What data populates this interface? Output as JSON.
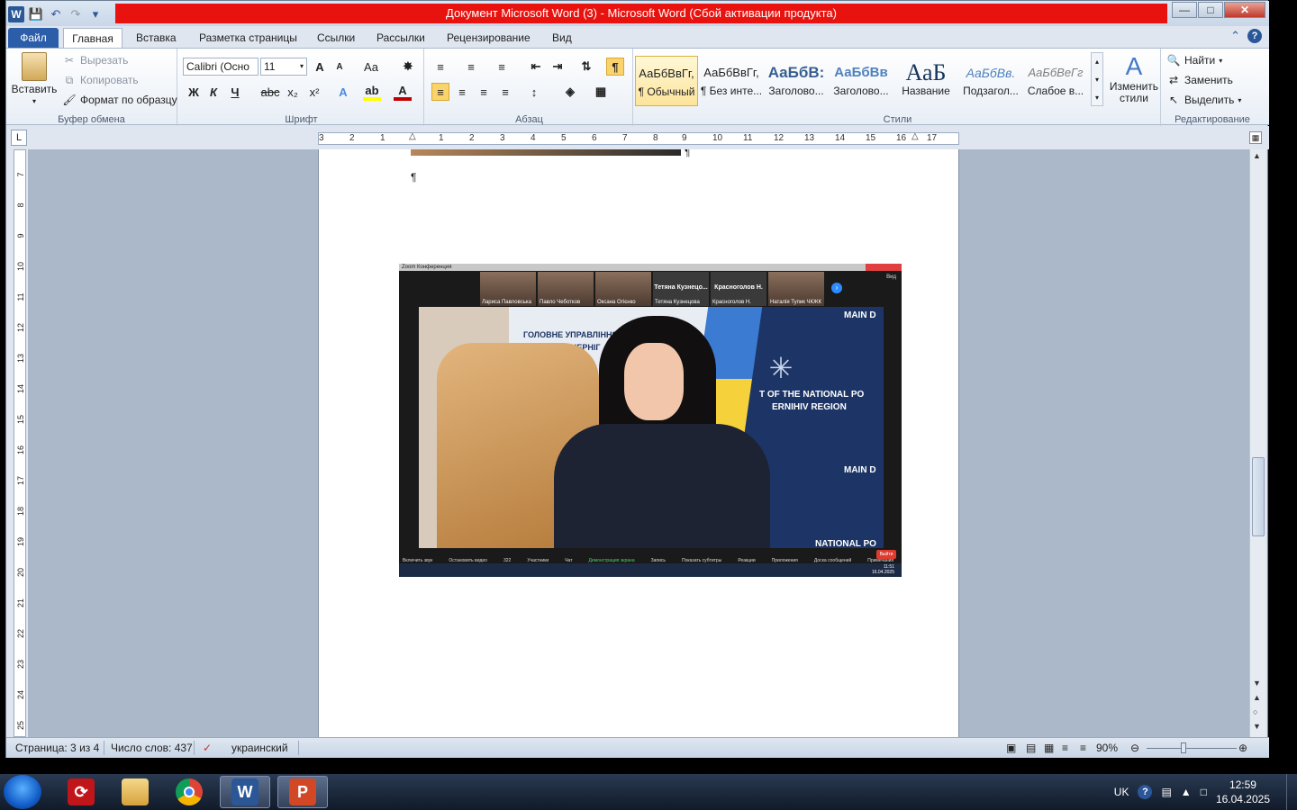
{
  "window": {
    "title": "Документ Microsoft Word (3)  -  Microsoft Word (Сбой активации продукта)"
  },
  "tabs": {
    "file": "Файл",
    "items": [
      "Главная",
      "Вставка",
      "Разметка страницы",
      "Ссылки",
      "Рассылки",
      "Рецензирование",
      "Вид"
    ]
  },
  "clipboard": {
    "paste": "Вставить",
    "cut": "Вырезать",
    "copy": "Копировать",
    "format_painter": "Формат по образцу",
    "label": "Буфер обмена"
  },
  "font": {
    "name": "Calibri (Осно",
    "size": "11",
    "label": "Шрифт",
    "bold": "Ж",
    "italic": "К",
    "underline": "Ч",
    "strike": "abc",
    "sub": "x₂",
    "sup": "x²",
    "grow": "A",
    "shrink": "A",
    "case": "Aa"
  },
  "paragraph": {
    "label": "Абзац",
    "pilcrow": "¶"
  },
  "styles": {
    "label": "Стили",
    "items": [
      {
        "sample": "АаБбВвГг,",
        "name": "¶ Обычный"
      },
      {
        "sample": "АаБбВвГг,",
        "name": "¶ Без инте..."
      },
      {
        "sample": "АаБбВ:",
        "name": "Заголово..."
      },
      {
        "sample": "АаБбВв",
        "name": "Заголово..."
      },
      {
        "sample": "АаБ",
        "name": "Название"
      },
      {
        "sample": "АаБбВв.",
        "name": "Подзагол..."
      },
      {
        "sample": "АаБбВеГг",
        "name": "Слабое в..."
      }
    ],
    "change": "Изменить стили"
  },
  "editing": {
    "label": "Редактирование",
    "find": "Найти",
    "replace": "Заменить",
    "select": "Выделить"
  },
  "ruler": {
    "corner": "L",
    "marks": [
      "3",
      "2",
      "1",
      "1",
      "2",
      "3",
      "4",
      "5",
      "6",
      "7",
      "8",
      "9",
      "10",
      "11",
      "12",
      "13",
      "14",
      "15",
      "16",
      "17"
    ],
    "vmarks": [
      "7",
      "8",
      "9",
      "10",
      "11",
      "12",
      "13",
      "14",
      "15",
      "16",
      "17",
      "18",
      "19",
      "20",
      "21",
      "22",
      "23",
      "24",
      "25"
    ]
  },
  "document": {
    "pilcrow1": "¶",
    "pilcrow2": "¶"
  },
  "embedded": {
    "zoom_title": "Zoom Конференция",
    "participants": [
      {
        "label": "Лариса Павловська"
      },
      {
        "label": "Павло Чеботков"
      },
      {
        "label": "Оксана Огієнко"
      },
      {
        "title": "Тетяна Кузнецо...",
        "label": "Тетяна Кузнецова"
      },
      {
        "title": "Красноголов Н.",
        "label": "Красноголов Н."
      },
      {
        "label": "Наталія Тупик ЧКЖК"
      }
    ],
    "view": "Вид",
    "banner_left_1": "ГОЛОВНЕ УПРАВЛІННЯ",
    "banner_left_2": "В ЧЕРНІГ",
    "banner_right_1": "MAIN D",
    "banner_right_2": "T OF THE NATIONAL PO",
    "banner_right_3": "ERNIHIV REGION",
    "banner_right_4": "MAIN D",
    "banner_right_5": "NATIONAL PO",
    "toolbar": [
      "Включить звук",
      "Остановить видео",
      "Участники",
      "Чат",
      "Демонстрация экрана",
      "Запись",
      "Показать субтитры",
      "Реакции",
      "Приложения",
      "Доска сообщений",
      "Примечания"
    ],
    "participants_count": "322",
    "exit": "Выйти",
    "time": "11:51",
    "date": "16.04.2025"
  },
  "statusbar": {
    "page": "Страница: 3 из 4",
    "words": "Число слов: 437",
    "language": "украинский",
    "zoom": "90%"
  },
  "taskbar": {
    "lang": "UK",
    "time": "12:59",
    "date": "16.04.2025"
  }
}
